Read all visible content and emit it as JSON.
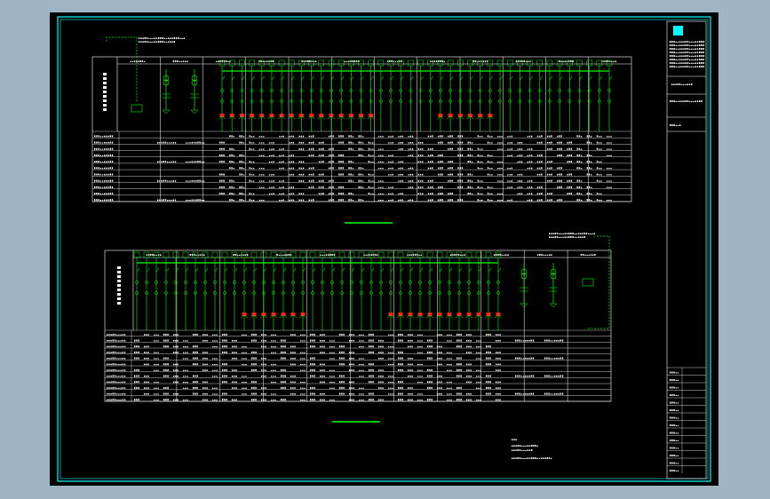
{
  "colors": {
    "app_background": "#9fb5c6",
    "sheet_background": "#000000",
    "border": "#00ffff",
    "table_lines": "#ffffff",
    "wiring": "#00ff00",
    "breaker_marks": "#ff2020",
    "text": "#ffffff",
    "divider": "#00ff00",
    "logo_block": "#00ffff"
  },
  "upper_diagram": {
    "row_count": 11,
    "panel_count": 12,
    "feeder_count": 40,
    "breaker_count": 22
  },
  "lower_diagram": {
    "row_count": 12,
    "panel_count": 11,
    "feeder_count": 38,
    "breaker_count": 19
  },
  "title_block": {
    "logo_icon": "square-logo-icon"
  }
}
